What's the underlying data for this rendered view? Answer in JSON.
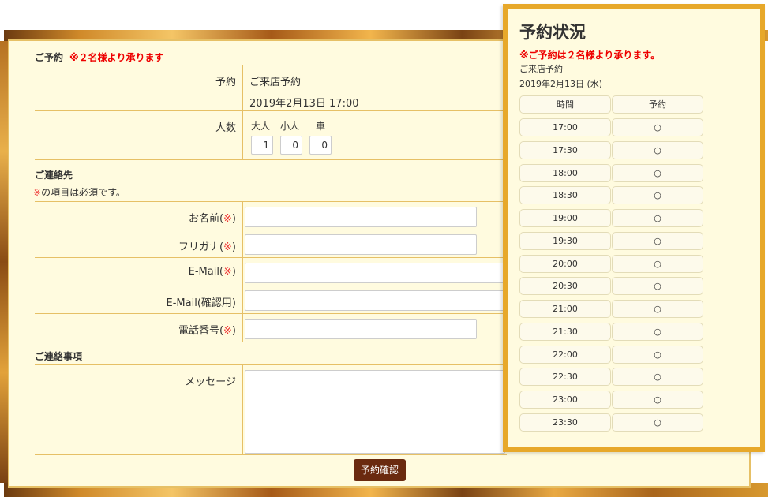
{
  "reservation": {
    "section_title": "ご予約",
    "section_note": "※２名様より承ります",
    "yoyaku_label": "予約",
    "yoyaku_type": "ご来店予約",
    "yoyaku_datetime": "2019年2月13日 17:00",
    "ninzu_label": "人数",
    "adult_label": "大人",
    "child_label": "小人",
    "car_label": "車",
    "adult_value": "1",
    "child_value": "0",
    "car_value": "0"
  },
  "contact": {
    "section_title": "ご連絡先",
    "required_mark": "※",
    "required_note": "の項目は必須です。",
    "name_label": "お名前(",
    "furigana_label": "フリガナ(",
    "email_label": "E-Mail(",
    "email_confirm_label": "E-Mail(確認用)",
    "phone_label": "電話番号(",
    "paren_close": ")"
  },
  "message": {
    "section_title": "ご連絡事項",
    "label": "メッセージ"
  },
  "submit": {
    "label": "予約確認"
  },
  "status_panel": {
    "title": "予約状況",
    "warning": "※ご予約は２名様より承ります。",
    "type": "ご来店予約",
    "date": "2019年2月13日 (水)",
    "header_time": "時間",
    "header_reserve": "予約",
    "slots": [
      {
        "time": "17:00",
        "mark": "○"
      },
      {
        "time": "17:30",
        "mark": "○"
      },
      {
        "time": "18:00",
        "mark": "○"
      },
      {
        "time": "18:30",
        "mark": "○"
      },
      {
        "time": "19:00",
        "mark": "○"
      },
      {
        "time": "19:30",
        "mark": "○"
      },
      {
        "time": "20:00",
        "mark": "○"
      },
      {
        "time": "20:30",
        "mark": "○"
      },
      {
        "time": "21:00",
        "mark": "○"
      },
      {
        "time": "21:30",
        "mark": "○"
      },
      {
        "time": "22:00",
        "mark": "○"
      },
      {
        "time": "22:30",
        "mark": "○"
      },
      {
        "time": "23:00",
        "mark": "○"
      },
      {
        "time": "23:30",
        "mark": "○"
      }
    ]
  }
}
